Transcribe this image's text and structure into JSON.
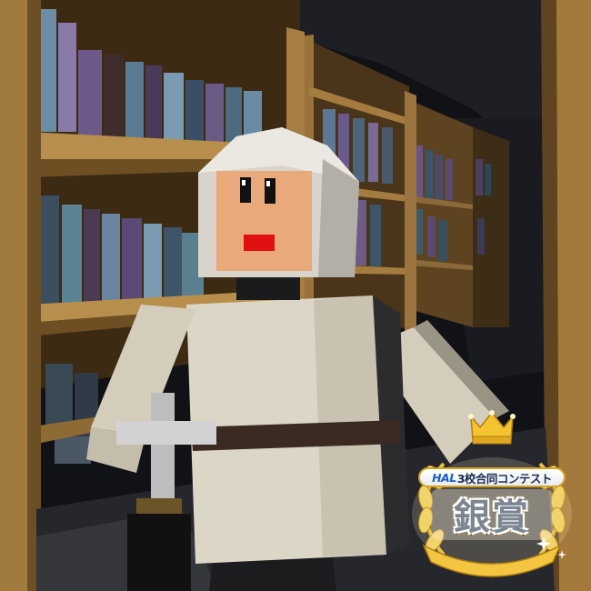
{
  "scene": {
    "type": "3d-game-render",
    "setting": "library-bookshelves",
    "character": "knight-in-white-tunic-holding-cross-sword",
    "colors": {
      "background": "#101114",
      "shelf_wood": "#a77d3e",
      "tunic": "#d8d2c2",
      "face": "#e9a97a",
      "mouth": "#e01010",
      "helmet": "#dedbd3",
      "belt": "#3a2a22"
    }
  },
  "award": {
    "contest_prefix": "HAL",
    "contest_text": "3校合同コンテスト",
    "prize_title": "銀賞",
    "icons": [
      "crown-icon",
      "laurel-icon",
      "sparkle-icon"
    ],
    "colors": {
      "gold": "#f4c430",
      "laurel": "#f1d36b",
      "text_dark": "#1a2e52"
    }
  }
}
